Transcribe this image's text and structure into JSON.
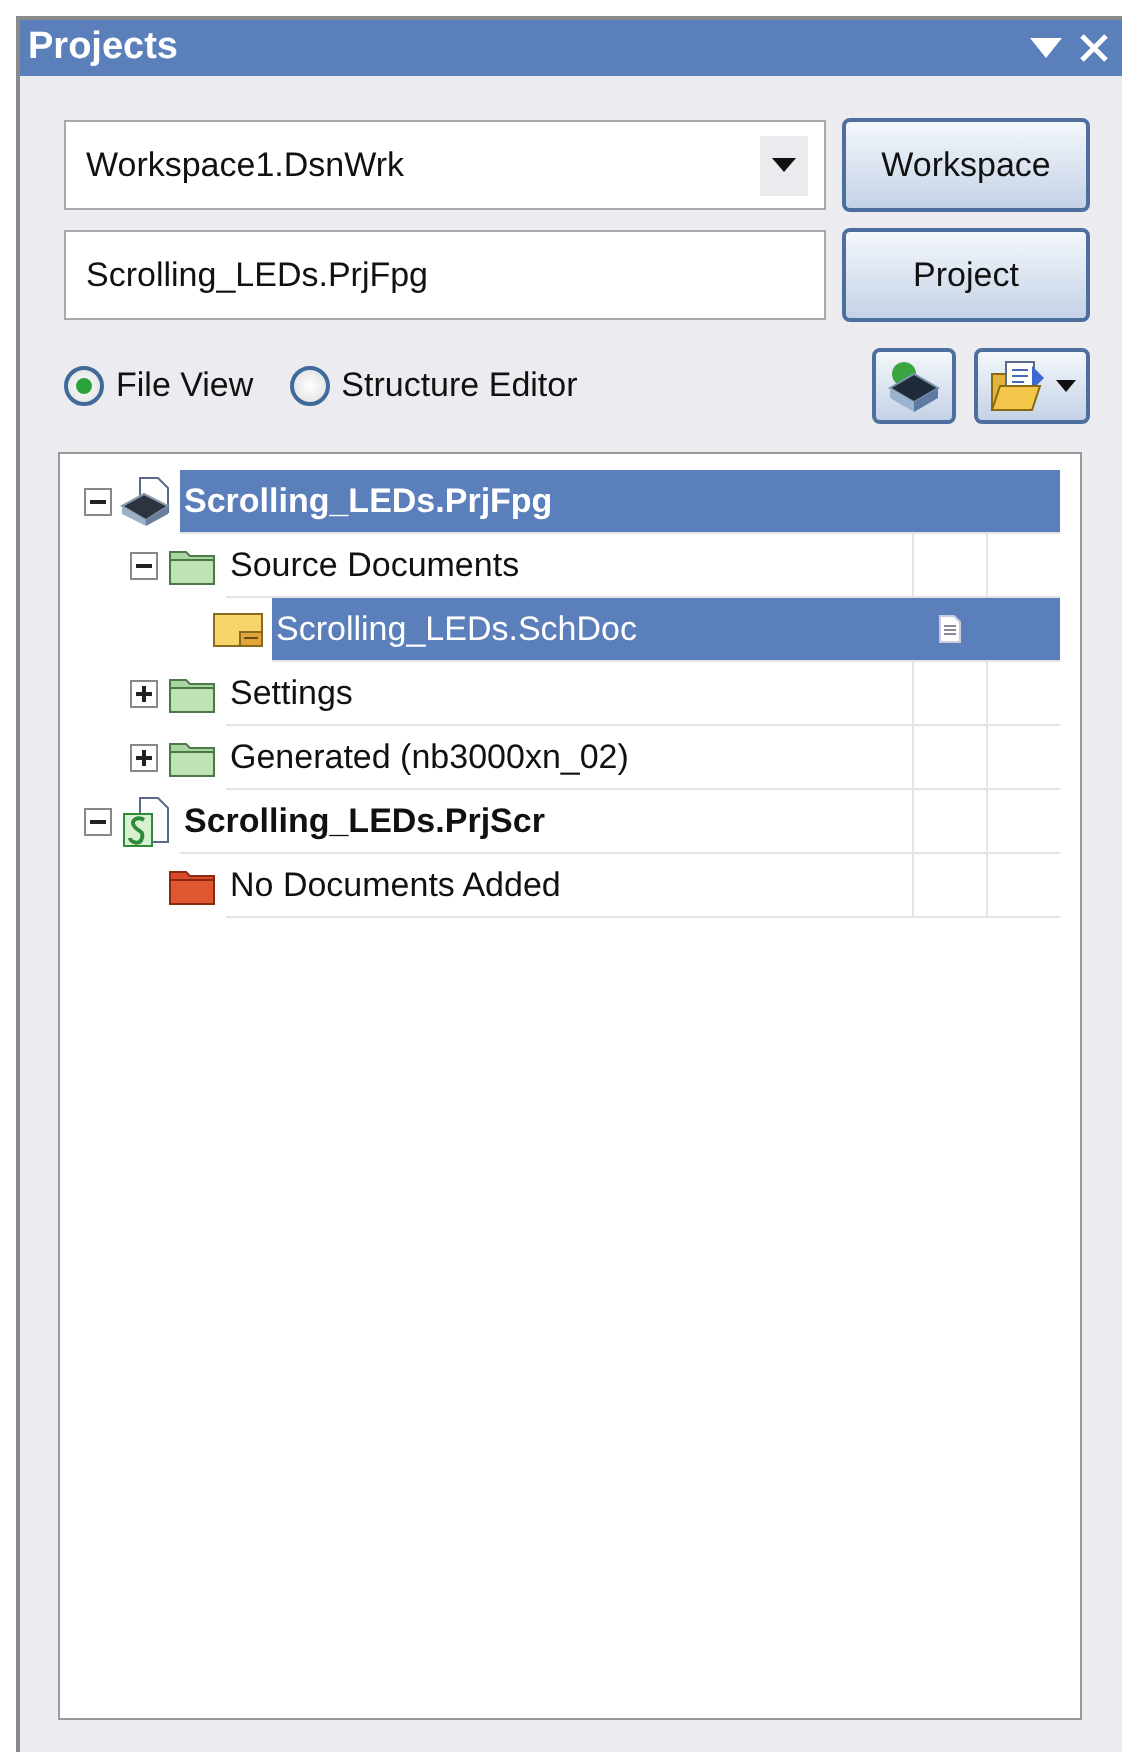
{
  "panel": {
    "title": "Projects"
  },
  "workspace_combo": {
    "value": "Workspace1.DsnWrk"
  },
  "workspace_button": "Workspace",
  "project_field": {
    "value": "Scrolling_LEDs.PrjFpg"
  },
  "project_button": "Project",
  "view_options": [
    {
      "label": "File View",
      "selected": true
    },
    {
      "label": "Structure Editor",
      "selected": false
    }
  ],
  "tree": [
    {
      "label": "Scrolling_LEDs.PrjFpg",
      "kind": "project",
      "bold": true,
      "selected": true,
      "expanded": true,
      "children": [
        {
          "label": "Source Documents",
          "kind": "folder",
          "bold": false,
          "selected": false,
          "expanded": true,
          "children": [
            {
              "label": "Scrolling_LEDs.SchDoc",
              "kind": "schematic",
              "bold": false,
              "selected": true,
              "status_icon": true
            }
          ]
        },
        {
          "label": "Settings",
          "kind": "folder",
          "bold": false,
          "selected": false,
          "expanded": false
        },
        {
          "label": "Generated (nb3000xn_02)",
          "kind": "folder",
          "bold": false,
          "selected": false,
          "expanded": false
        }
      ]
    },
    {
      "label": "Scrolling_LEDs.PrjScr",
      "kind": "script",
      "bold": true,
      "selected": false,
      "expanded": true,
      "children": [
        {
          "label": "No Documents Added",
          "kind": "empty-folder",
          "bold": false,
          "selected": false
        }
      ]
    }
  ]
}
